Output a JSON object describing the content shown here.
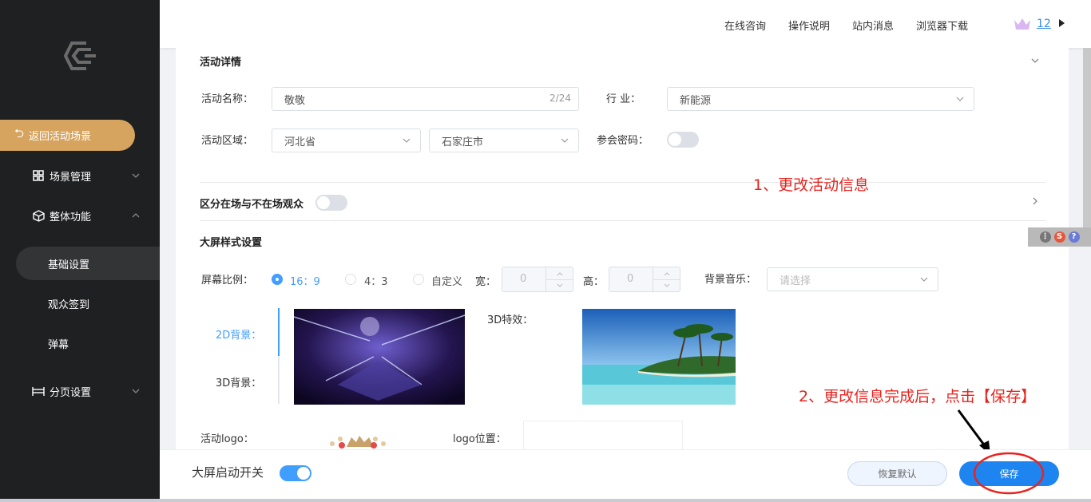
{
  "sidebar": {
    "back_label": "返回活动场景",
    "nav_scene": "场景管理",
    "nav_overall": "整体功能",
    "sub_basic": "基础设置",
    "sub_checkin": "观众签到",
    "sub_danmaku": "弹幕",
    "nav_paging": "分页设置"
  },
  "header": {
    "links": [
      "在线咨询",
      "操作说明",
      "站内消息",
      "浏览器下载"
    ],
    "level": "12"
  },
  "details": {
    "section_title": "活动详情",
    "name_label": "活动名称：",
    "name_value": "敬敬",
    "name_counter": "2/24",
    "industry_label": "行 业：",
    "industry_value": "新能源",
    "region_label": "活动区域：",
    "province_value": "河北省",
    "city_value": "石家庄市",
    "password_label": "参会密码："
  },
  "audience": {
    "title": "区分在场与不在场观众"
  },
  "screen": {
    "section_title": "大屏样式设置",
    "ratio_label": "屏幕比例：",
    "ratio_options": [
      "16：9",
      "4：3",
      "自定义"
    ],
    "width_label": "宽：",
    "width_value": "0",
    "height_label": "高：",
    "height_value": "0",
    "music_label": "背景音乐：",
    "music_placeholder": "请选择",
    "bg2d_tab": "2D背景：",
    "bg3d_tab": "3D背景：",
    "effect_label": "3D特效：",
    "logo_label": "活动logo：",
    "logo_position_label": "logo位置："
  },
  "annotations": {
    "step1": "1、更改活动信息",
    "step2": "2、更改信息完成后，点击【保存】"
  },
  "bottom": {
    "switch_label": "大屏启动开关",
    "reset_label": "恢复默认",
    "save_label": "保存"
  },
  "colors": {
    "accent": "#409eff",
    "sidebar_bg": "#1f2022",
    "back_button": "#d6a45f",
    "annotation": "#e8231e"
  }
}
